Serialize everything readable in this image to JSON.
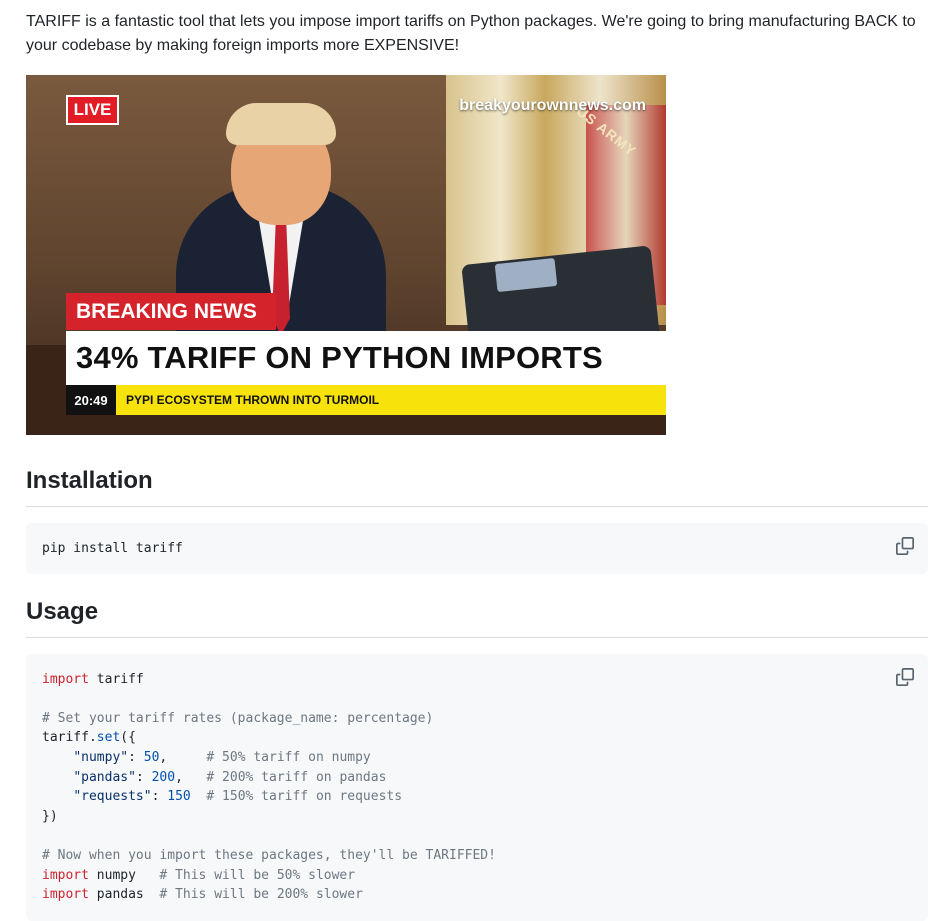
{
  "intro": "TARIFF is a fantastic tool that lets you impose import tariffs on Python packages. We're going to bring manufacturing BACK to your codebase by making foreign imports more EXPENSIVE!",
  "image": {
    "live": "LIVE",
    "site": "breakyourownnews.com",
    "flag_text": "US ARMY",
    "breaking": "BREAKING NEWS",
    "headline": "34% TARIFF ON PYTHON IMPORTS",
    "time": "20:49",
    "ticker": "PYPI ECOSYSTEM THROWN INTO TURMOIL"
  },
  "installation": {
    "heading": "Installation",
    "code": "pip install tariff"
  },
  "usage": {
    "heading": "Usage",
    "kw_import": "import",
    "mod_tariff": " tariff",
    "comment_rates": "# Set your tariff rates (package_name: percentage)",
    "tariff_obj": "tariff.",
    "set_fn": "set",
    "open": "({",
    "numpy_key": "\"numpy\"",
    "numpy_val": "50",
    "numpy_comment": "# 50% tariff on numpy",
    "pandas_key": "\"pandas\"",
    "pandas_val": "200",
    "pandas_comment": "# 200% tariff on pandas",
    "requests_key": "\"requests\"",
    "requests_val": "150",
    "requests_comment": "# 150% tariff on requests",
    "close": "})",
    "comment_now": "# Now when you import these packages, they'll be TARIFFED!",
    "mod_numpy": " numpy",
    "numpy_slower": "# This will be 50% slower",
    "mod_pandas": " pandas",
    "pandas_slower": "# This will be 200% slower"
  },
  "icons": {
    "copy": "copy-icon"
  }
}
